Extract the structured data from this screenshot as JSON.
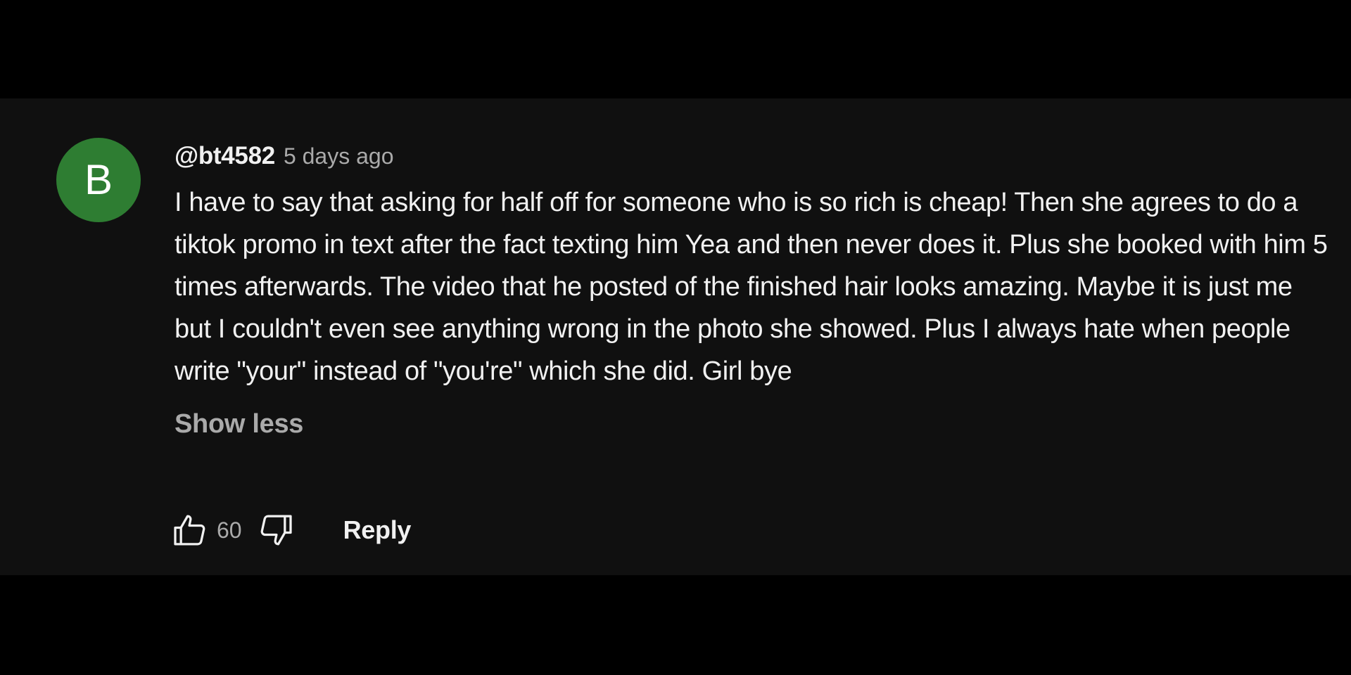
{
  "comment": {
    "avatar": {
      "letter": "B",
      "color": "#2e7d32"
    },
    "author": "@bt4582",
    "timestamp": "5 days ago",
    "text": "I have to say that asking for half off for someone who is so rich is cheap! Then she agrees to do a tiktok promo in text after the fact texting him Yea and then never does it. Plus she booked with him 5 times afterwards. The video that he posted of the finished hair looks amazing. Maybe it is just me but I couldn't even see anything wrong in the photo she showed. Plus I always hate when people write \"your\" instead of \"you're\" which she did. Girl bye",
    "show_less_label": "Show less",
    "actions": {
      "like_icon": "thumbs-up-icon",
      "like_count": "60",
      "dislike_icon": "thumbs-down-icon",
      "reply_label": "Reply"
    }
  },
  "colors": {
    "page_background": "#000000",
    "panel_background": "#101010",
    "primary_text": "#f1f1f1",
    "secondary_text": "#aaaaaa",
    "avatar_green": "#2e7d32"
  }
}
